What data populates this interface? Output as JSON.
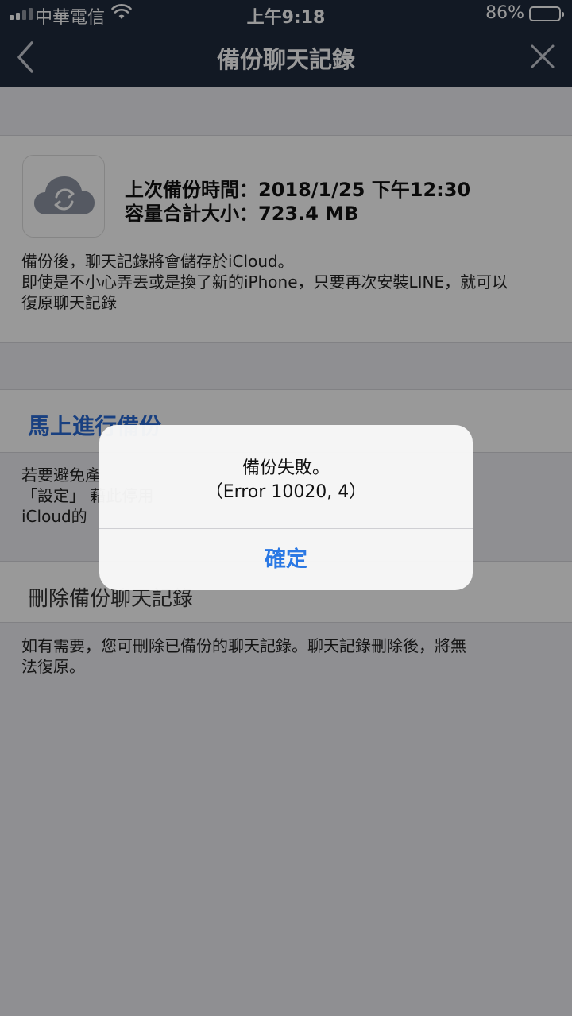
{
  "status_bar": {
    "carrier": "中華電信",
    "time": "上午9:18",
    "battery_percent": "86%",
    "battery_level": 0.86,
    "icons": [
      "signal-icon",
      "wifi-icon",
      "battery-icon"
    ]
  },
  "nav": {
    "title": "備份聊天記錄",
    "back_icon": "chevron-left-icon",
    "close_icon": "close-icon"
  },
  "backup_info": {
    "icon": "icloud-sync-icon",
    "last_backup": "上次備份時間：2018/1/25 下午12:30",
    "total_size": "容量合計大小：723.4 MB",
    "description": "備份後，聊天記錄將會儲存於iCloud。\n即使是不小心弄丟或是換了新的iPhone，只要再次安裝LINE，就可以\n復原聊天記錄"
  },
  "backup_now": {
    "label": "馬上進行備份",
    "note": "若要避免產\n「設定」          藉此停用\niCloud的 "
  },
  "delete_backup": {
    "label": "刪除備份聊天記錄",
    "description": "如有需要，您可刪除已備份的聊天記錄。聊天記錄刪除後，將無\n法復原。"
  },
  "alert": {
    "message": "備份失敗。\n（Error 10020, 4）",
    "confirm_label": "確定"
  },
  "colors": {
    "nav_background": "#1f2a3d",
    "link_blue": "#2a6bd6",
    "alert_button": "#2a78e4"
  }
}
